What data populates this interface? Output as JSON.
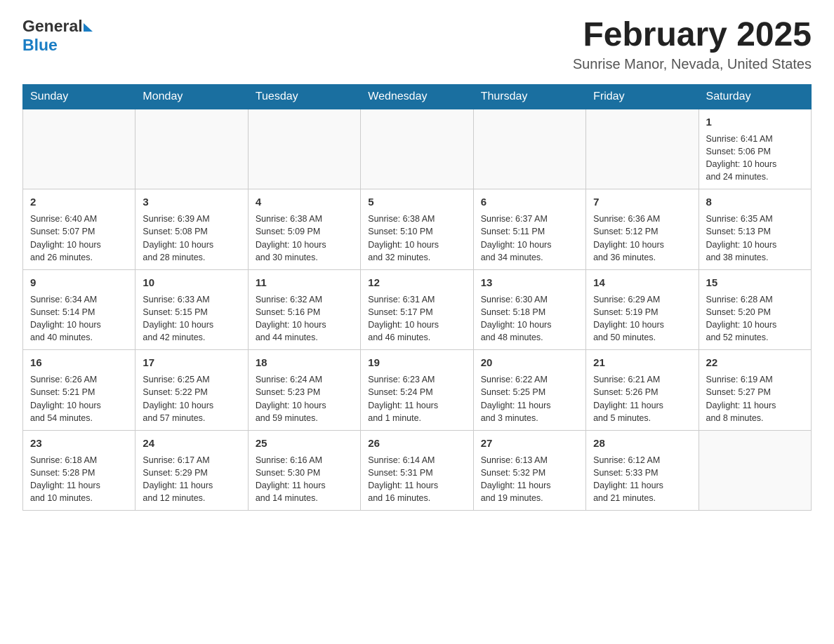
{
  "logo": {
    "general": "General",
    "blue": "Blue"
  },
  "title": "February 2025",
  "subtitle": "Sunrise Manor, Nevada, United States",
  "days_of_week": [
    "Sunday",
    "Monday",
    "Tuesday",
    "Wednesday",
    "Thursday",
    "Friday",
    "Saturday"
  ],
  "weeks": [
    [
      {
        "day": "",
        "info": ""
      },
      {
        "day": "",
        "info": ""
      },
      {
        "day": "",
        "info": ""
      },
      {
        "day": "",
        "info": ""
      },
      {
        "day": "",
        "info": ""
      },
      {
        "day": "",
        "info": ""
      },
      {
        "day": "1",
        "info": "Sunrise: 6:41 AM\nSunset: 5:06 PM\nDaylight: 10 hours\nand 24 minutes."
      }
    ],
    [
      {
        "day": "2",
        "info": "Sunrise: 6:40 AM\nSunset: 5:07 PM\nDaylight: 10 hours\nand 26 minutes."
      },
      {
        "day": "3",
        "info": "Sunrise: 6:39 AM\nSunset: 5:08 PM\nDaylight: 10 hours\nand 28 minutes."
      },
      {
        "day": "4",
        "info": "Sunrise: 6:38 AM\nSunset: 5:09 PM\nDaylight: 10 hours\nand 30 minutes."
      },
      {
        "day": "5",
        "info": "Sunrise: 6:38 AM\nSunset: 5:10 PM\nDaylight: 10 hours\nand 32 minutes."
      },
      {
        "day": "6",
        "info": "Sunrise: 6:37 AM\nSunset: 5:11 PM\nDaylight: 10 hours\nand 34 minutes."
      },
      {
        "day": "7",
        "info": "Sunrise: 6:36 AM\nSunset: 5:12 PM\nDaylight: 10 hours\nand 36 minutes."
      },
      {
        "day": "8",
        "info": "Sunrise: 6:35 AM\nSunset: 5:13 PM\nDaylight: 10 hours\nand 38 minutes."
      }
    ],
    [
      {
        "day": "9",
        "info": "Sunrise: 6:34 AM\nSunset: 5:14 PM\nDaylight: 10 hours\nand 40 minutes."
      },
      {
        "day": "10",
        "info": "Sunrise: 6:33 AM\nSunset: 5:15 PM\nDaylight: 10 hours\nand 42 minutes."
      },
      {
        "day": "11",
        "info": "Sunrise: 6:32 AM\nSunset: 5:16 PM\nDaylight: 10 hours\nand 44 minutes."
      },
      {
        "day": "12",
        "info": "Sunrise: 6:31 AM\nSunset: 5:17 PM\nDaylight: 10 hours\nand 46 minutes."
      },
      {
        "day": "13",
        "info": "Sunrise: 6:30 AM\nSunset: 5:18 PM\nDaylight: 10 hours\nand 48 minutes."
      },
      {
        "day": "14",
        "info": "Sunrise: 6:29 AM\nSunset: 5:19 PM\nDaylight: 10 hours\nand 50 minutes."
      },
      {
        "day": "15",
        "info": "Sunrise: 6:28 AM\nSunset: 5:20 PM\nDaylight: 10 hours\nand 52 minutes."
      }
    ],
    [
      {
        "day": "16",
        "info": "Sunrise: 6:26 AM\nSunset: 5:21 PM\nDaylight: 10 hours\nand 54 minutes."
      },
      {
        "day": "17",
        "info": "Sunrise: 6:25 AM\nSunset: 5:22 PM\nDaylight: 10 hours\nand 57 minutes."
      },
      {
        "day": "18",
        "info": "Sunrise: 6:24 AM\nSunset: 5:23 PM\nDaylight: 10 hours\nand 59 minutes."
      },
      {
        "day": "19",
        "info": "Sunrise: 6:23 AM\nSunset: 5:24 PM\nDaylight: 11 hours\nand 1 minute."
      },
      {
        "day": "20",
        "info": "Sunrise: 6:22 AM\nSunset: 5:25 PM\nDaylight: 11 hours\nand 3 minutes."
      },
      {
        "day": "21",
        "info": "Sunrise: 6:21 AM\nSunset: 5:26 PM\nDaylight: 11 hours\nand 5 minutes."
      },
      {
        "day": "22",
        "info": "Sunrise: 6:19 AM\nSunset: 5:27 PM\nDaylight: 11 hours\nand 8 minutes."
      }
    ],
    [
      {
        "day": "23",
        "info": "Sunrise: 6:18 AM\nSunset: 5:28 PM\nDaylight: 11 hours\nand 10 minutes."
      },
      {
        "day": "24",
        "info": "Sunrise: 6:17 AM\nSunset: 5:29 PM\nDaylight: 11 hours\nand 12 minutes."
      },
      {
        "day": "25",
        "info": "Sunrise: 6:16 AM\nSunset: 5:30 PM\nDaylight: 11 hours\nand 14 minutes."
      },
      {
        "day": "26",
        "info": "Sunrise: 6:14 AM\nSunset: 5:31 PM\nDaylight: 11 hours\nand 16 minutes."
      },
      {
        "day": "27",
        "info": "Sunrise: 6:13 AM\nSunset: 5:32 PM\nDaylight: 11 hours\nand 19 minutes."
      },
      {
        "day": "28",
        "info": "Sunrise: 6:12 AM\nSunset: 5:33 PM\nDaylight: 11 hours\nand 21 minutes."
      },
      {
        "day": "",
        "info": ""
      }
    ]
  ]
}
